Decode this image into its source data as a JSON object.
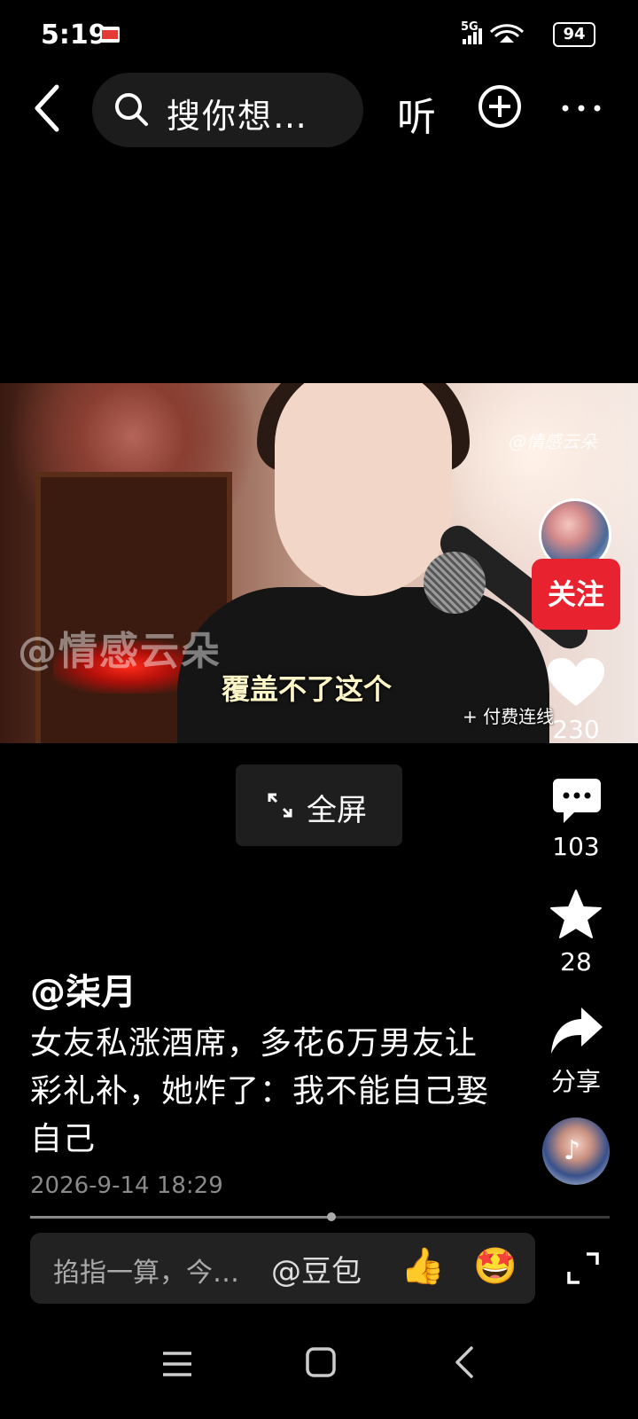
{
  "status_bar": {
    "time": "5:19",
    "network": "5G",
    "battery": "94"
  },
  "top_bar": {
    "search_placeholder": "搜你想…",
    "listen_label": "听"
  },
  "video": {
    "watermark_left": "@情感云朵",
    "watermark_right": "@情感云朵",
    "subtitle": "覆盖不了这个",
    "paid_link": "+ 付费连线"
  },
  "sidebar": {
    "follow_label": "关注",
    "like_count": "230",
    "comment_count": "103",
    "favorite_count": "28",
    "share_label": "分享"
  },
  "fullscreen": {
    "label": "全屏"
  },
  "post": {
    "author": "@柒月",
    "title": "女友私涨酒席，多花6万男友让彩礼补，她炸了：我不能自己娶自己",
    "date": "2026-9-14 18:29",
    "progress": 0.52
  },
  "comment_bar": {
    "placeholder": "掐指一算，今…",
    "mention": "@豆包",
    "emoji_thumb": "👍",
    "emoji_star": "🤩"
  },
  "colors": {
    "follow": "#e8232f",
    "background": "#000000"
  }
}
